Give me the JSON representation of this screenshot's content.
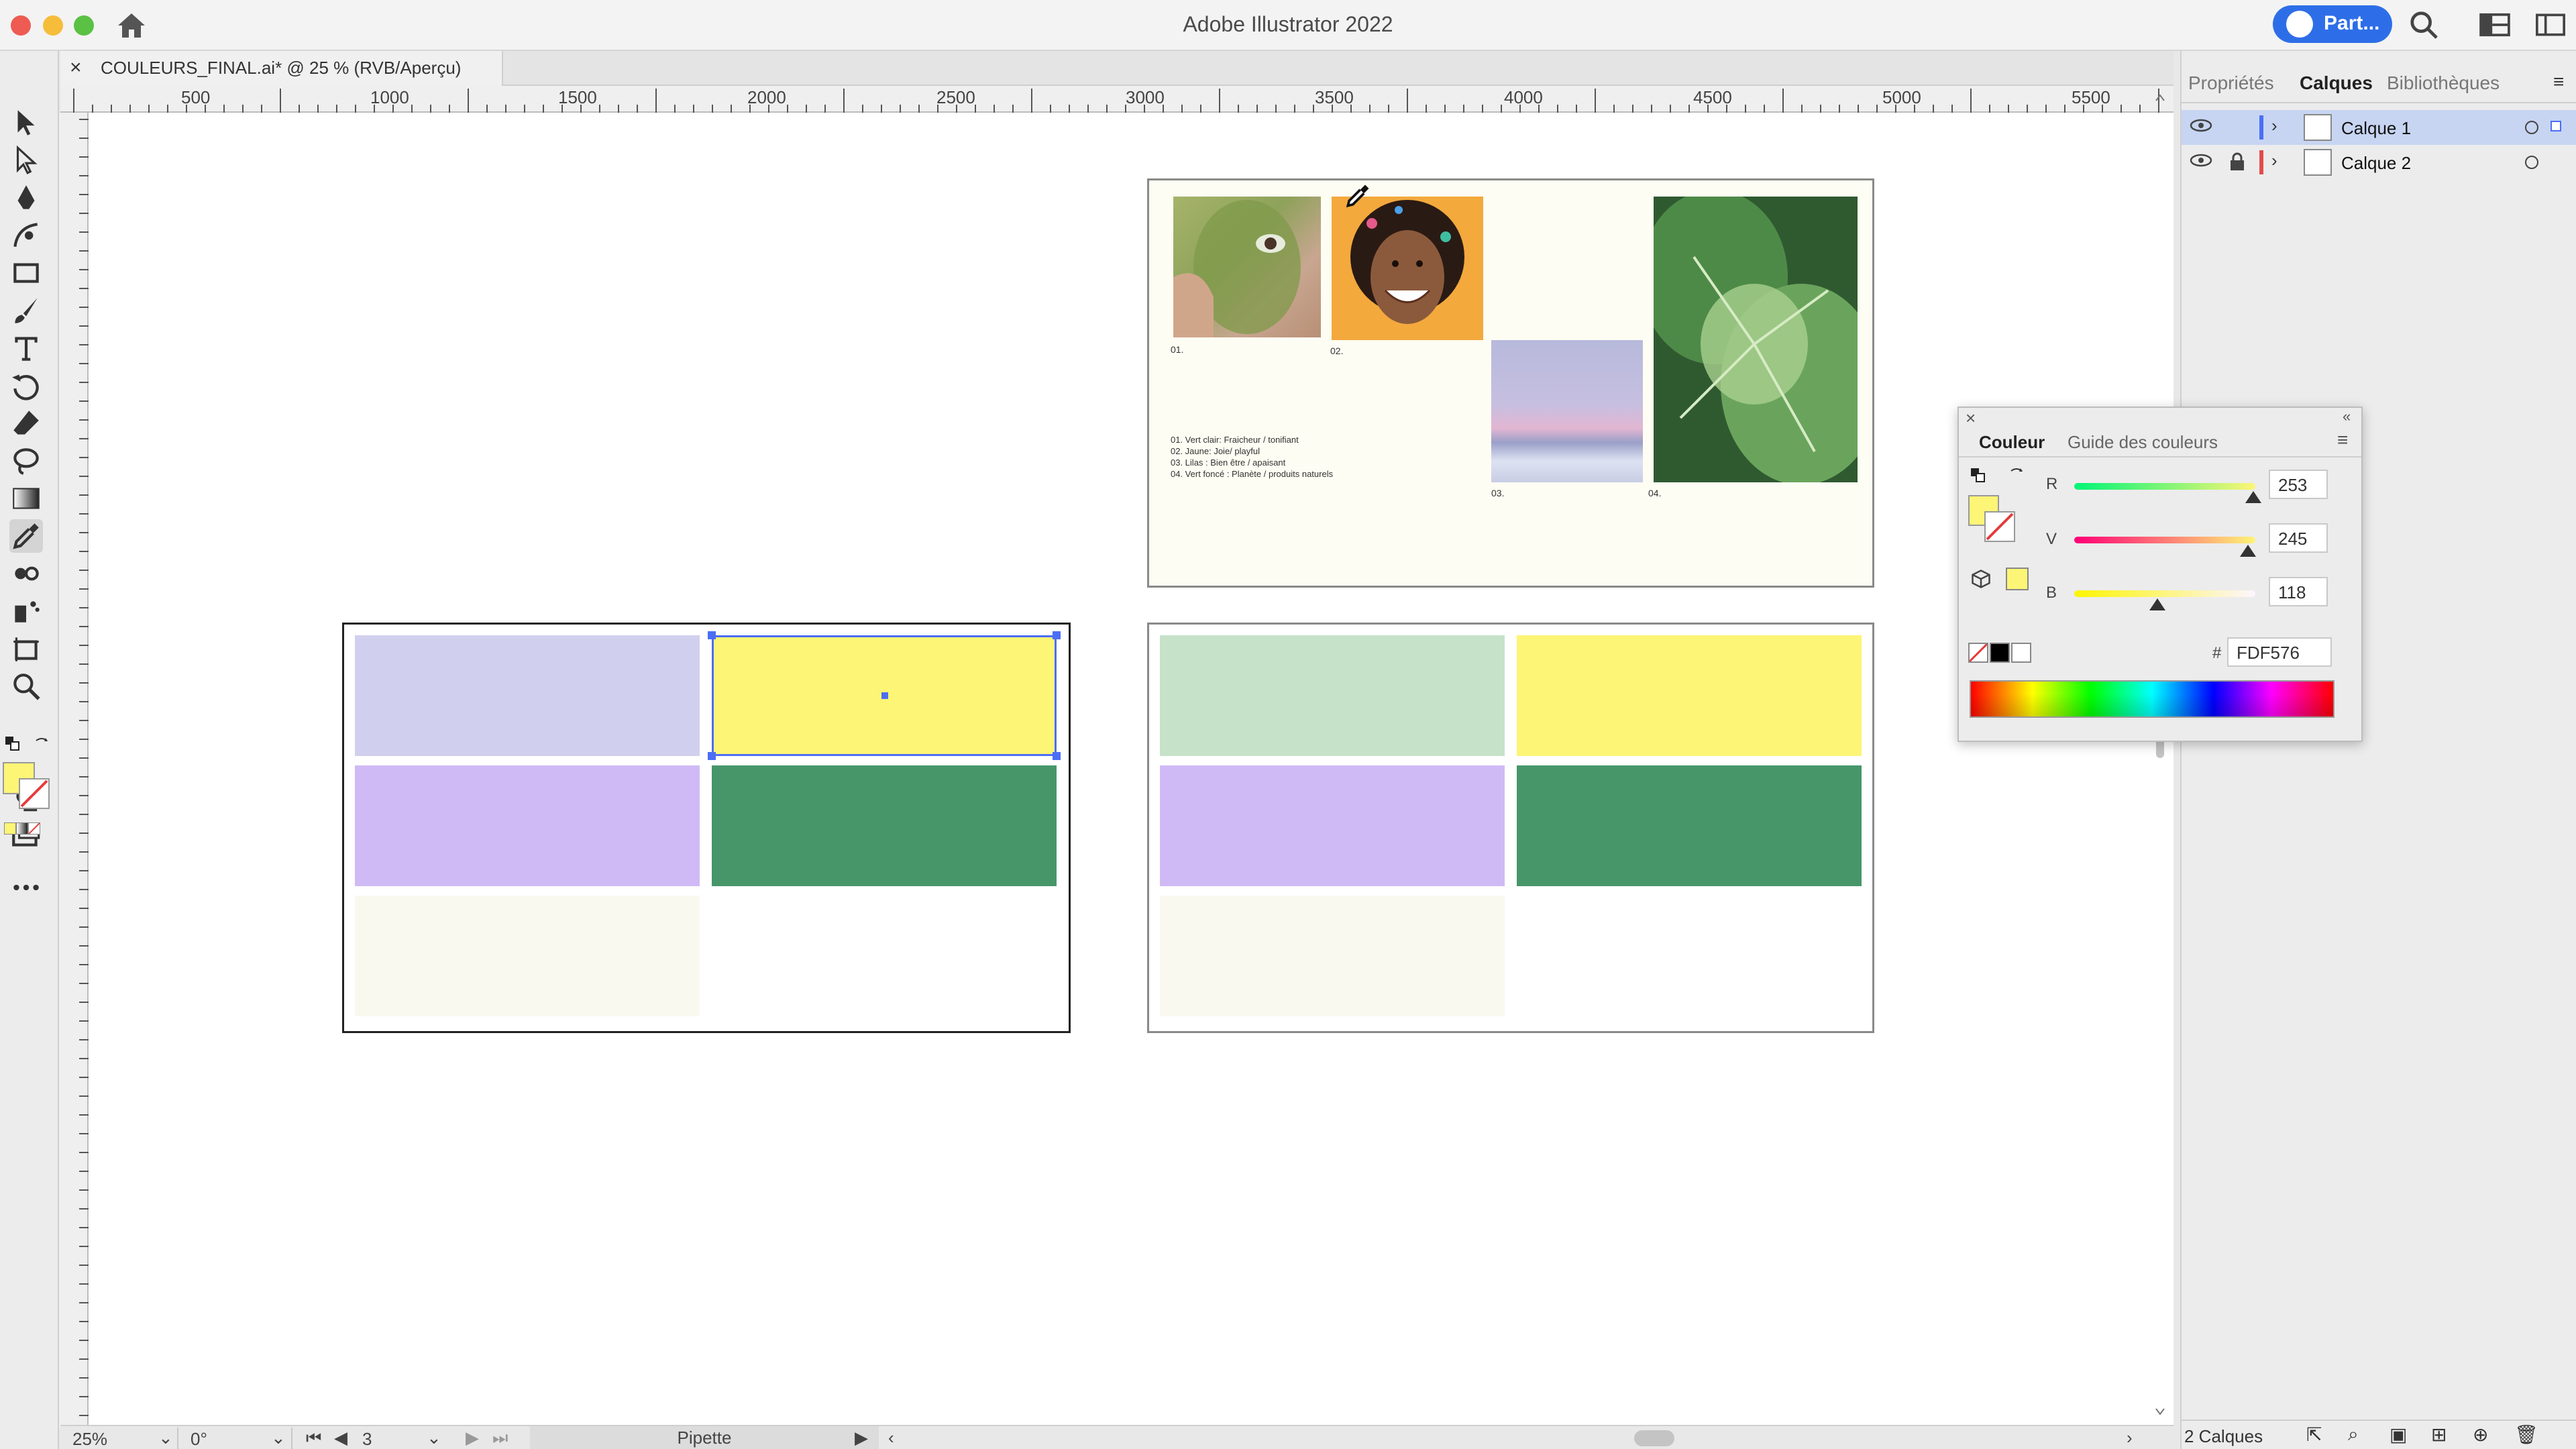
{
  "window": {
    "title": "Adobe Illustrator 2022",
    "share_label": "Part..."
  },
  "document_tab": {
    "title": "COULEURS_FINAL.ai* @ 25 % (RVB/Aperçu)"
  },
  "ruler": {
    "h_labels": [
      "500",
      "1000",
      "1500",
      "2000",
      "2500",
      "3000",
      "3500",
      "4000",
      "4500",
      "5000",
      "5500"
    ]
  },
  "moodboard": {
    "labels": [
      "01.",
      "02.",
      "03.",
      "04."
    ],
    "legend": [
      "01. Vert clair: Fraicheur / tonifiant",
      "02. Jaune: Joie/ playful",
      "03. Lilas : Bien être / apaisant",
      "04. Vert foncé : Planète / produits naturels"
    ]
  },
  "colors": {
    "lavender": "#d0d0ee",
    "yellow": "#fdf576",
    "lilac": "#d0baf6",
    "green_dark": "#46966a",
    "cream": "#f9f9ef",
    "mint": "#c6e2c8"
  },
  "right_panel": {
    "tabs": [
      "Propriétés",
      "Calques",
      "Bibliothèques"
    ],
    "layers": [
      {
        "name": "Calque 1",
        "color": "#4b6ef5"
      },
      {
        "name": "Calque 2",
        "color": "#e54b4b"
      }
    ],
    "footer_count": "2 Calques"
  },
  "color_panel": {
    "tabs": [
      "Couleur",
      "Guide des couleurs"
    ],
    "channels": [
      {
        "label": "R",
        "value": "253",
        "level": 0.99
      },
      {
        "label": "V",
        "value": "245",
        "level": 0.96
      },
      {
        "label": "B",
        "value": "118",
        "level": 0.46
      }
    ],
    "hex_label": "#",
    "hex_value": "FDF576"
  },
  "status": {
    "zoom": "25%",
    "rotation": "0°",
    "artboard": "3",
    "tool_name": "Pipette"
  }
}
